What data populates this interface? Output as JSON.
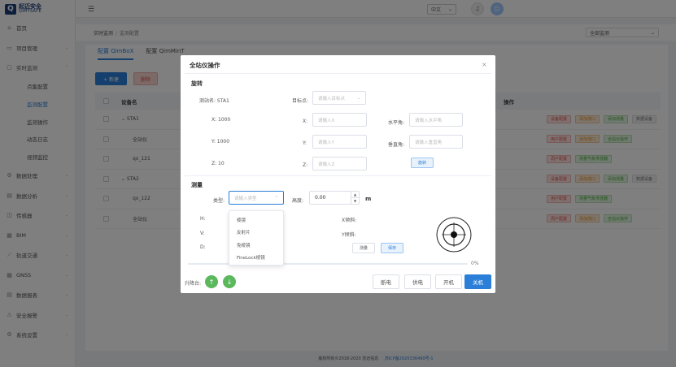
{
  "brand": {
    "name_cn": "起迈安全",
    "name_en": "QIMYSAFE",
    "mark": "Q"
  },
  "sidebar": {
    "items": [
      {
        "label": "首页",
        "icon": "home-icon",
        "glyph": "⌂"
      },
      {
        "label": "项目管理",
        "icon": "folder-icon",
        "glyph": "▭",
        "arrow": "⌄"
      },
      {
        "label": "实时监测",
        "icon": "monitor-icon",
        "glyph": "▢",
        "arrow": "⌃"
      },
      {
        "label": "数据处理",
        "icon": "gear-icon",
        "glyph": "⚙",
        "arrow": "⌄"
      },
      {
        "label": "数据分析",
        "icon": "analysis-icon",
        "glyph": "▤",
        "arrow": "⌄"
      },
      {
        "label": "传感器",
        "icon": "sensor-icon",
        "glyph": "◫",
        "arrow": "⌄"
      },
      {
        "label": "BIM",
        "icon": "bim-icon",
        "glyph": "▦",
        "arrow": "⌄"
      },
      {
        "label": "轨道交通",
        "icon": "rail-icon",
        "glyph": "⟋",
        "arrow": "⌄"
      },
      {
        "label": "GNSS",
        "icon": "gnss-icon",
        "glyph": "▦",
        "arrow": "⌄"
      },
      {
        "label": "数据报表",
        "icon": "report-icon",
        "glyph": "▤",
        "arrow": "⌄"
      },
      {
        "label": "安全报警",
        "icon": "alarm-icon",
        "glyph": "⚠",
        "arrow": "⌄"
      },
      {
        "label": "系统设置",
        "icon": "settings-icon",
        "glyph": "⚙",
        "arrow": "⌄"
      }
    ],
    "sub_items": [
      "点集配置",
      "监测配置",
      "监测操作",
      "动态日志",
      "视频监控"
    ]
  },
  "topbar": {
    "menu_glyph": "☰",
    "lang": "中文",
    "lang_arrow": "⌄",
    "bell_glyph": "♫",
    "avatar_glyph": "☺"
  },
  "breadcrumb": {
    "first": "实时监测",
    "sep": "/",
    "current": "监测配置",
    "select": "全部监测",
    "select_arrow": "⌄"
  },
  "tabs": [
    "配置 QimBoX",
    "配置 QimMinT"
  ],
  "actions": {
    "new": "+ 新建",
    "delete": "删除"
  },
  "table": {
    "headers": {
      "name": "设备名",
      "ops": "操作"
    },
    "rows": [
      {
        "name": "⌄ STA1",
        "ops": [
          [
            "设备配置",
            "red"
          ],
          [
            "添加测口",
            "orange"
          ],
          [
            "添加测量",
            "green"
          ],
          [
            "数据设备",
            "gray"
          ]
        ]
      },
      {
        "name": "全站仪",
        "ops": [
          [
            "用户配置",
            "red"
          ],
          [
            "添加测口",
            "orange"
          ],
          [
            "全站仪操作",
            "green"
          ]
        ]
      },
      {
        "name": "qx_121",
        "ops": [
          [
            "周户配置",
            "red"
          ],
          [
            "测量气象传感器",
            "green"
          ]
        ]
      },
      {
        "name": "⌄ STA2",
        "ops": [
          [
            "设备配置",
            "red"
          ],
          [
            "添加测口",
            "orange"
          ],
          [
            "添加测量",
            "green"
          ],
          [
            "数据设备",
            "gray"
          ]
        ]
      },
      {
        "name": "qx_122",
        "ops": [
          [
            "用户配置",
            "red"
          ],
          [
            "测量气象传感器",
            "green"
          ]
        ]
      },
      {
        "name": "全站仪",
        "ops": [
          [
            "周户配置",
            "red"
          ],
          [
            "添加测口",
            "orange"
          ],
          [
            "全站仪操作",
            "green"
          ]
        ]
      }
    ]
  },
  "footer": {
    "copyright": "版权所有©2018-2020 苏迈信息",
    "icp": "苏ICP备2020136490号-1"
  },
  "modal": {
    "title": "全站仪操作",
    "close": "×",
    "rotate": {
      "title": "旋转",
      "station": "测站名: STA1",
      "target_label": "目标点:",
      "target_placeholder": "请输入目标点",
      "x_value": "X: 1000",
      "y_value": "Y: 1000",
      "z_value": "Z: 10",
      "x_label": "X:",
      "x_placeholder": "请输入X",
      "y_label": "Y:",
      "y_placeholder": "请输入Y",
      "z_label": "Z:",
      "z_placeholder": "请输入Z",
      "h_angle_label": "水平角:",
      "h_angle_placeholder": "请输入水平角",
      "v_angle_label": "垂直角:",
      "v_angle_placeholder": "请输入垂直角",
      "rotate_button": "旋转"
    },
    "measure": {
      "title": "测量",
      "type_label": "类型:",
      "type_placeholder": "请输入类型",
      "height_label": "高度:",
      "height_value": "0.00",
      "unit": "m",
      "h_label": "H:",
      "v_label": "V:",
      "d_label": "D:",
      "x_tilt": "X倾斜:",
      "y_tilt": "Y倾斜:",
      "measure_button": "测量",
      "save_button": "保存",
      "progress_percent": 0,
      "progress_text": "0%",
      "type_options": [
        "棱镜",
        "反射片",
        "免棱镜",
        "FineLock棱镜"
      ]
    },
    "lift_label": "升降台:",
    "footer_buttons": {
      "power_off": "断电",
      "power_on": "供电",
      "start": "开机",
      "shutdown": "关机"
    }
  },
  "colors": {
    "primary": "#2b7fd9",
    "success": "#5cb85c",
    "danger": "#d9534f"
  }
}
